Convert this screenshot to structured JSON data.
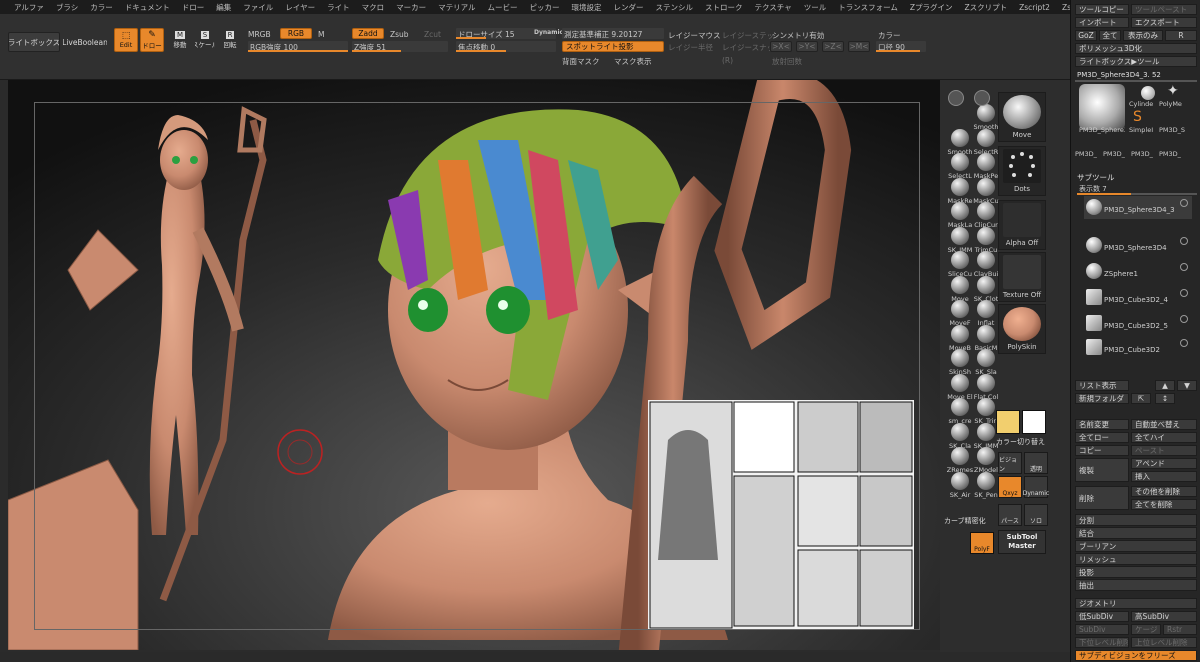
{
  "menubar": [
    "アルファ",
    "ブラシ",
    "カラー",
    "ドキュメント",
    "ドロー",
    "編集",
    "ファイル",
    "レイヤー",
    "ライト",
    "マクロ",
    "マーカー",
    "マテリアル",
    "ムービー",
    "ピッカー",
    "環境設定",
    "レンダー",
    "ステンシル",
    "ストローク",
    "テクスチャ",
    "ツール",
    "トランスフォーム",
    "Zプラグイン",
    "Zスクリプト",
    "Zscript2",
    "Zscript3"
  ],
  "toolbar": {
    "lightbox": "ライトボックス",
    "liveboolean": "LiveBoolean",
    "edit": "Edit",
    "draw": "ドロー",
    "move": "移動",
    "scale": "スケール",
    "rotate": "回転",
    "mrgb": "MRGB",
    "rgb": "RGB",
    "m": "M",
    "rgb_intensity": "RGB強度 100",
    "zadd": "Zadd",
    "zsub": "Zsub",
    "zcut": "Zcut",
    "z_intensity": "Z強度 51",
    "draw_size": "ドローサイズ 15",
    "dynamic": "Dynamic",
    "focal_shift": "焦点移動 0",
    "measure": "測定基準補正 9.20127",
    "spotlight": "スポットライト投影",
    "back_mask": "背面マスク",
    "mask_display": "マスク表示",
    "r": "(R)",
    "lazy_mouse": "レイジーマウス",
    "lazy_step": "レイジーステッ",
    "lazy_radius": "レイジー半径",
    "lazy_snap": "レイジースナッ",
    "symmetry": "シンメトリ有効",
    "x": ">X<",
    "y": ">Y<",
    "z": ">Z<",
    "m2": ">M<",
    "radial_count": "放射回数",
    "color": "カラー",
    "aperture": "口径 90"
  },
  "shelf": {
    "brushes": [
      "Smooth",
      "Smooth",
      "SelectR",
      "SelectL",
      "MaskPe",
      "MaskRe",
      "MaskCu",
      "MaskLa",
      "ClipCur",
      "SK_IMM",
      "TrimCu",
      "SliceCu",
      "ClayBui",
      "Move",
      "SK_Clot",
      "MoveF",
      "Inflat",
      "MoveB",
      "BasicM",
      "SkinSh",
      "SK_Sla",
      "Move El",
      "Flat Col",
      "sm_cre",
      "SK_Trin",
      "SK_Cla",
      "SK_IMM",
      "ZRemes",
      "ZModel",
      "SK_Air",
      "SK_Pen"
    ],
    "tiles": [
      "Move",
      "Dots",
      "Alpha Off",
      "Texture Off",
      "PolySkin"
    ],
    "color_switch": "カラー切り替え",
    "curve_refine": "カーブ精密化",
    "polyf": "PolyF",
    "subtool_master_1": "SubTool",
    "subtool_master_2": "Master",
    "small": [
      "ビジョン",
      "透明",
      "Dynamic",
      "ソロ",
      "パース"
    ]
  },
  "rpanel": {
    "copy_tool": "ツールコピー",
    "paste_tool": "ツールペースト",
    "import": "インポート",
    "export": "エクスポート",
    "goz": "GoZ",
    "all": "全て",
    "visible_only": "表示のみ",
    "r": "R",
    "polymesh3d": "ポリメッシュ3D化",
    "lightbox_tool": "ライトボックス▶ツール",
    "current_tool": "PM3D_Sphere3D4_3. 52",
    "tool_thumbs": [
      "PM3D_Sphere3",
      "Cylinde",
      "PolyMe",
      "SimpleI",
      "PM3D_S",
      "PM3D_",
      "PM3D_",
      "PM3D_",
      "PM3D_"
    ],
    "subtool_header": "サブツール",
    "display_count": "表示数 7",
    "subtools": [
      "PM3D_Sphere3D4_3",
      "PM3D_Sphere3D4",
      "ZSphere1",
      "PM3D_Cube3D2_4",
      "PM3D_Cube3D2_5",
      "PM3D_Cube3D2"
    ],
    "list_display": "リスト表示",
    "new_folder": "新規フォルダ",
    "rename": "名前変更",
    "auto_reorder": "自動並べ替え",
    "all_low": "全てロー",
    "all_high": "全てハイ",
    "copy": "コピー",
    "paste": "ペースト",
    "duplicate": "複製",
    "append": "アペンド",
    "insert": "挿入",
    "delete": "削除",
    "delete_others": "その他を削除",
    "delete_all": "全てを削除",
    "split": "分割",
    "merge": "結合",
    "boolean": "ブーリアン",
    "remesh": "リメッシュ",
    "project": "投影",
    "extract": "抽出",
    "geometry_header": "ジオメトリ",
    "lower_subdiv": "低SubDiv",
    "higher_subdiv": "高SubDiv",
    "subdiv": "SubDiv",
    "cage": "ケージ",
    "rstr": "Rstr",
    "del_lower": "下位レベル削除",
    "del_higher": "上位レベル削除",
    "freeze_subdiv": "サブディビジョンをフリーズ"
  },
  "colors": {
    "accent": "#e8882b",
    "skin": "#c98a6f",
    "bg": "#181818"
  }
}
